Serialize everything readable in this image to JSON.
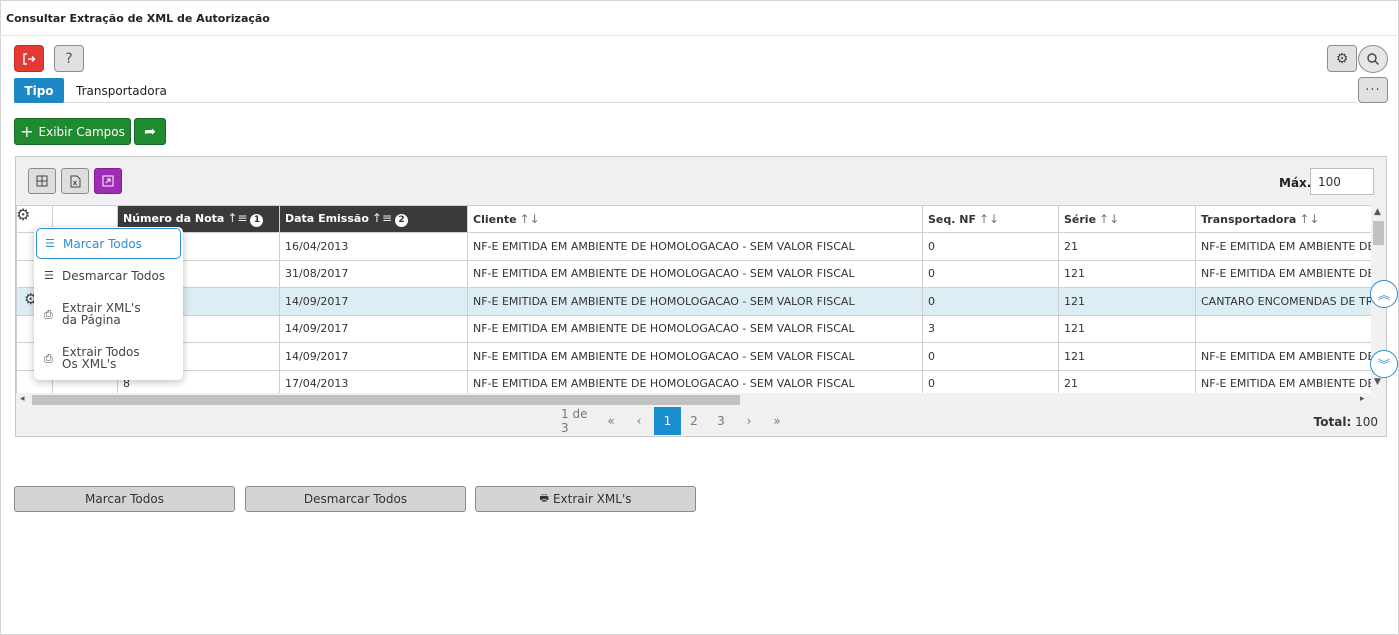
{
  "window": {
    "title": "Consultar Extração de XML de Autorização"
  },
  "filter": {
    "label": "Tipo",
    "value": "Transportadora"
  },
  "toolbar": {
    "exibir_label": "Exibir Campos"
  },
  "grid": {
    "max_label": "Máx.",
    "max_value": "100",
    "columns": [
      {
        "label": "Número da Nota",
        "order": "1"
      },
      {
        "label": "Data Emissão",
        "order": "2"
      },
      {
        "label": "Cliente"
      },
      {
        "label": "Seq. NF"
      },
      {
        "label": "Série"
      },
      {
        "label": "Transportadora"
      }
    ],
    "rows": [
      {
        "numero": "",
        "data": "16/04/2013",
        "cliente": "NF-E EMITIDA EM AMBIENTE DE HOMOLOGACAO - SEM VALOR FISCAL",
        "seq": "0",
        "serie": "21",
        "transp": "NF-E EMITIDA EM AMBIENTE DE HOMOLOGACAO"
      },
      {
        "numero": "",
        "data": "31/08/2017",
        "cliente": "NF-E EMITIDA EM AMBIENTE DE HOMOLOGACAO - SEM VALOR FISCAL",
        "seq": "0",
        "serie": "121",
        "transp": "NF-E EMITIDA EM AMBIENTE DE HOMOLOGACAO"
      },
      {
        "numero": "",
        "data": "14/09/2017",
        "cliente": "NF-E EMITIDA EM AMBIENTE DE HOMOLOGACAO - SEM VALOR FISCAL",
        "seq": "0",
        "serie": "121",
        "transp": "CANTARO ENCOMENDAS DE TRANSPORTES"
      },
      {
        "numero": "",
        "data": "14/09/2017",
        "cliente": "NF-E EMITIDA EM AMBIENTE DE HOMOLOGACAO - SEM VALOR FISCAL",
        "seq": "3",
        "serie": "121",
        "transp": ""
      },
      {
        "numero": "",
        "data": "14/09/2017",
        "cliente": "NF-E EMITIDA EM AMBIENTE DE HOMOLOGACAO - SEM VALOR FISCAL",
        "seq": "0",
        "serie": "121",
        "transp": "NF-E EMITIDA EM AMBIENTE DE HOMOLOGACAO"
      },
      {
        "numero": "8",
        "data": "17/04/2013",
        "cliente": "NF-E EMITIDA EM AMBIENTE DE HOMOLOGACAO - SEM VALOR FISCAL",
        "seq": "0",
        "serie": "21",
        "transp": "NF-E EMITIDA EM AMBIENTE DE HOMOLOGACAO"
      }
    ],
    "selected_row": 2
  },
  "context_menu": {
    "items": [
      {
        "label": "Marcar Todos",
        "icon": "list-icon"
      },
      {
        "label": "Desmarcar Todos",
        "icon": "list-icon"
      },
      {
        "label": "Extrair XML's da Página",
        "icon": "print-icon"
      },
      {
        "label": "Extrair Todos Os XML's",
        "icon": "print-icon"
      }
    ]
  },
  "pager": {
    "summary": "1 de 3",
    "pages": [
      "1",
      "2",
      "3"
    ],
    "current": "1",
    "total_label": "Total:",
    "total_value": "100"
  },
  "actions": {
    "marcar": "Marcar Todos",
    "desmarcar": "Desmarcar Todos",
    "extrair": "Extrair XML's"
  },
  "colors": {
    "accent": "#1a8fd0",
    "danger": "#e53935",
    "success": "#1f8a2f",
    "purple": "#a02bb5",
    "header_dark": "#3a3a3a",
    "selected_row": "#dceef3"
  }
}
